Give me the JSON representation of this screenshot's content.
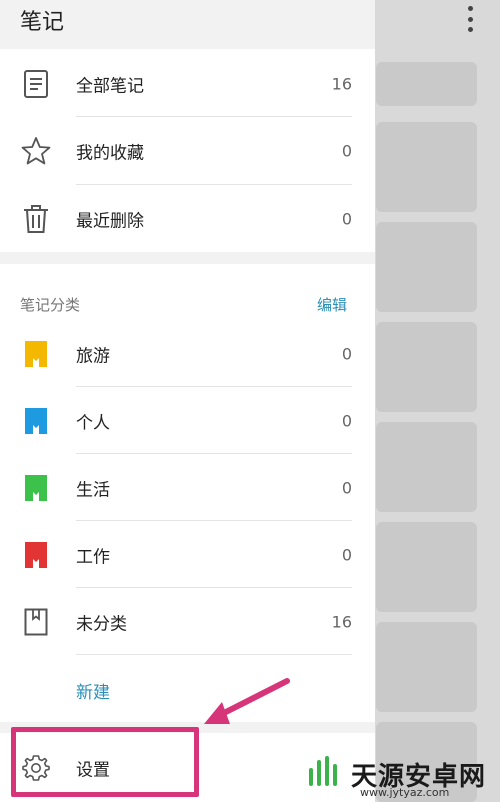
{
  "app": {
    "title": "笔记"
  },
  "main_nav": [
    {
      "icon": "notes-icon",
      "label": "全部笔记",
      "count": "16"
    },
    {
      "icon": "star-icon",
      "label": "我的收藏",
      "count": "0"
    },
    {
      "icon": "trash-icon",
      "label": "最近删除",
      "count": "0"
    }
  ],
  "categories": {
    "header": "笔记分类",
    "edit_label": "编辑",
    "items": [
      {
        "icon": "folder-yellow-icon",
        "label": "旅游",
        "count": "0",
        "color": "#f5b800"
      },
      {
        "icon": "folder-blue-icon",
        "label": "个人",
        "count": "0",
        "color": "#1e9be0"
      },
      {
        "icon": "folder-green-icon",
        "label": "生活",
        "count": "0",
        "color": "#3cc14a"
      },
      {
        "icon": "folder-red-icon",
        "label": "工作",
        "count": "0",
        "color": "#e23434"
      },
      {
        "icon": "folder-outline-icon",
        "label": "未分类",
        "count": "16",
        "color": "#555555"
      }
    ],
    "new_label": "新建"
  },
  "settings": {
    "icon": "gear-icon",
    "label": "设置"
  },
  "annotation": {
    "highlight_color": "#d6357a"
  },
  "watermark": {
    "text": "天源安卓网",
    "url": "www.jytyaz.com"
  }
}
